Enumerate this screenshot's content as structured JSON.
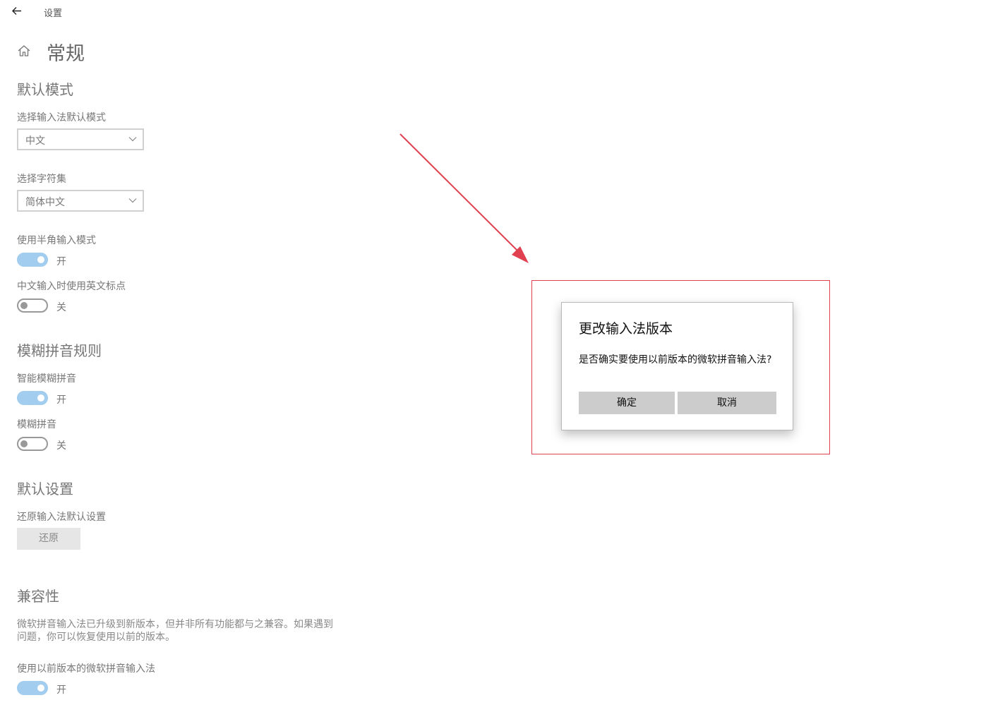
{
  "app": {
    "title": "设置"
  },
  "header": {
    "title": "常规"
  },
  "sections": {
    "default_mode": {
      "title": "默认模式",
      "input_mode": {
        "label": "选择输入法默认模式",
        "value": "中文"
      },
      "charset": {
        "label": "选择字符集",
        "value": "简体中文"
      },
      "half_width": {
        "label": "使用半角输入模式",
        "state": "开",
        "on": true
      },
      "en_punct": {
        "label": "中文输入时使用英文标点",
        "state": "关",
        "on": false
      }
    },
    "fuzzy": {
      "title": "模糊拼音规则",
      "smart": {
        "label": "智能模糊拼音",
        "state": "开",
        "on": true
      },
      "fuzzy_pinyin": {
        "label": "模糊拼音",
        "state": "关",
        "on": false
      }
    },
    "defaults": {
      "title": "默认设置",
      "label": "还原输入法默认设置",
      "button": "还原"
    },
    "compat": {
      "title": "兼容性",
      "description": "微软拼音输入法已升级到新版本，但并非所有功能都与之兼容。如果遇到问题，你可以恢复使用以前的版本。",
      "prev_version": {
        "label": "使用以前版本的微软拼音输入法",
        "state": "开",
        "on": true
      }
    }
  },
  "dialog": {
    "title": "更改输入法版本",
    "message": "是否确实要使用以前版本的微软拼音输入法?",
    "ok": "确定",
    "cancel": "取消"
  },
  "colors": {
    "toggle_on": "#a3cdee",
    "annotation_red": "#e04050"
  }
}
